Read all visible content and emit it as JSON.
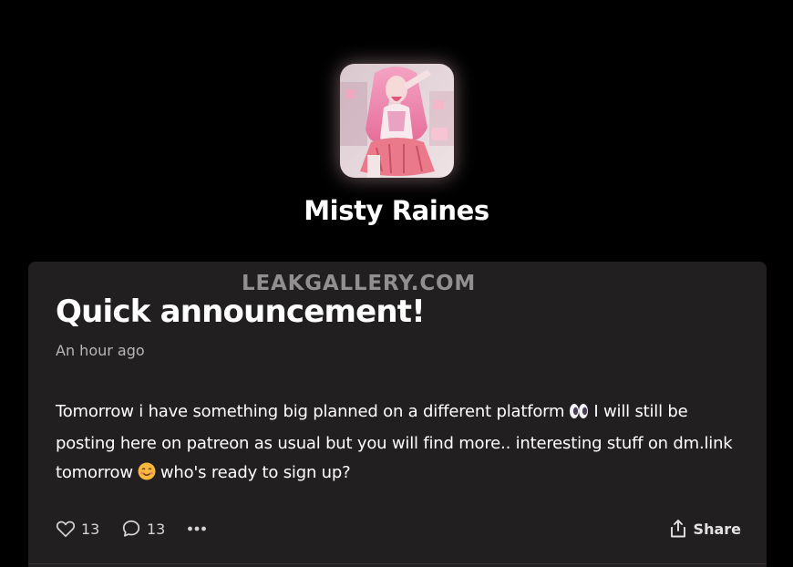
{
  "creator": {
    "name": "Misty Raines",
    "avatar_alt": "creator-avatar"
  },
  "watermark": "LEAKGALLERY.COM",
  "post": {
    "title": "Quick announcement!",
    "time": "An hour ago",
    "body_line1_a": "Tomorrow i have something big planned on a different platform",
    "body_line1_b": "I will still be",
    "body_line2": "posting here on patreon as usual but you will find more.. interesting stuff on dm.link",
    "body_line3_a": "tomorrow",
    "body_line3_b": "who's ready to sign up?",
    "emoji_1": "eyes-emoji",
    "emoji_2": "smiling-face-emoji"
  },
  "actions": {
    "likes": "13",
    "comments": "13",
    "share_label": "Share"
  },
  "colors": {
    "background": "#000000",
    "card": "#221f21",
    "muted_text": "#b9b6b8",
    "icon": "#d6d3d5"
  }
}
